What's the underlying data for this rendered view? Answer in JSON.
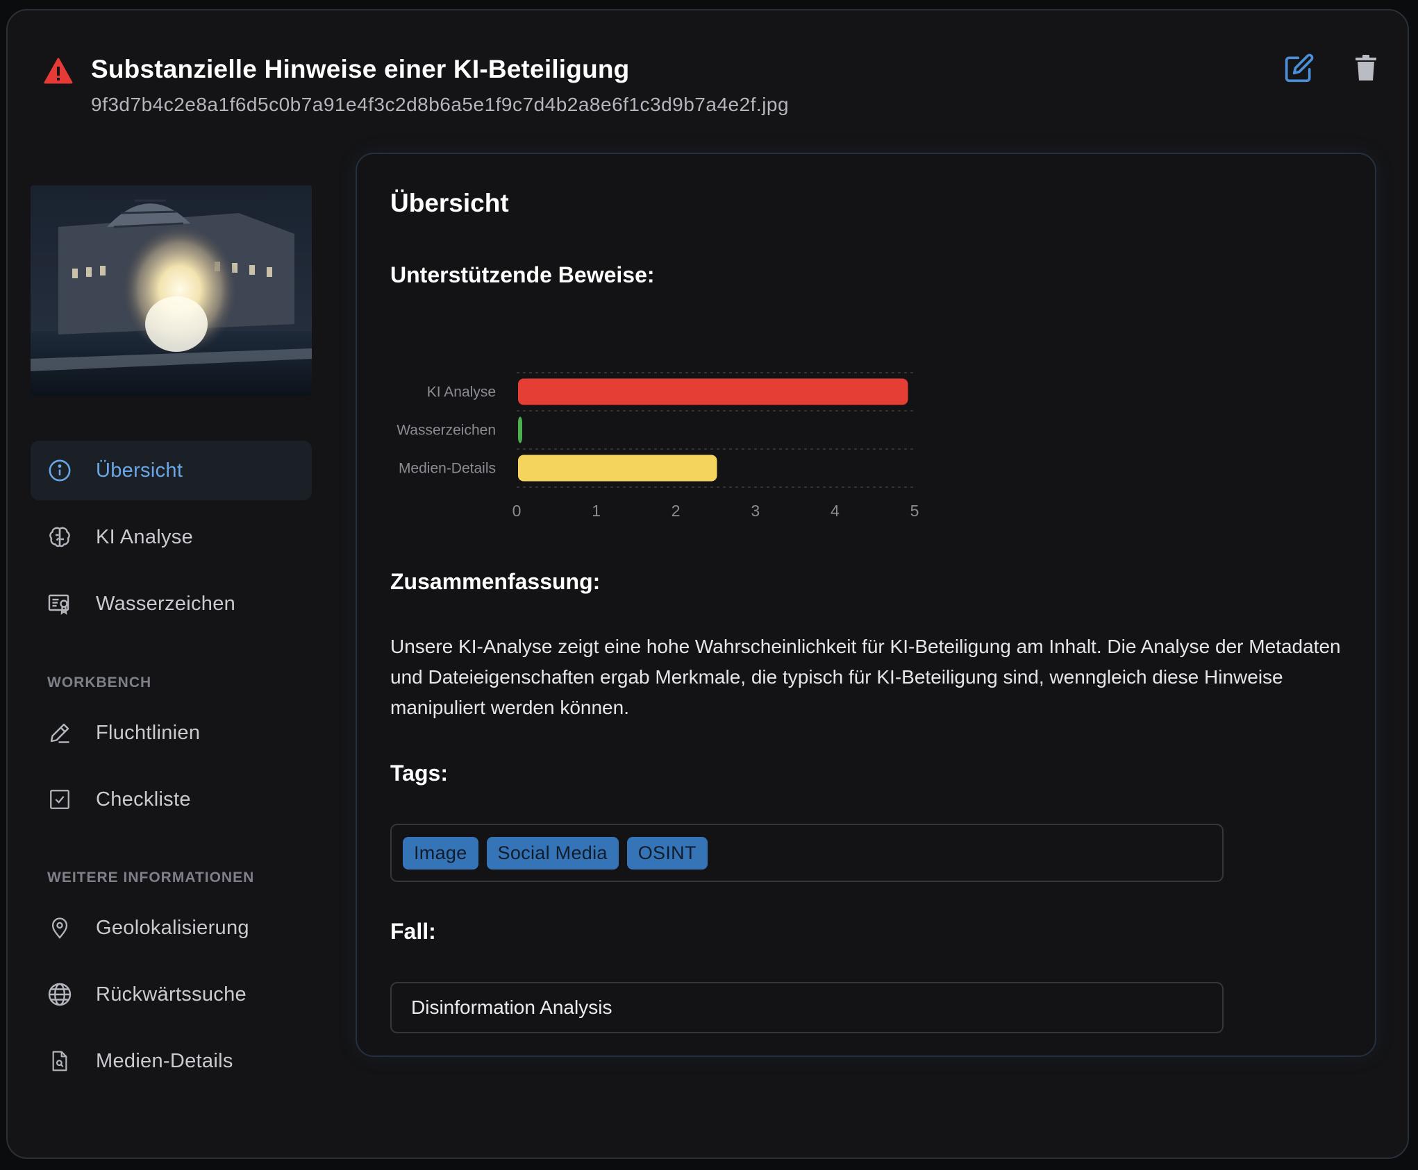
{
  "header": {
    "title": "Substanzielle Hinweise einer KI-Beteiligung",
    "filename": "9f3d7b4c2e8a1f6d5c0b7a91e4f3c2d8b6a5e1f9c7d4b2a8e6f1c3d9b7a4e2f.jpg",
    "warning_icon": "warning-triangle-icon",
    "edit_icon": "edit-icon",
    "delete_icon": "trash-icon",
    "colors": {
      "warning": "#e53a36",
      "edit": "#4a8fd8",
      "delete": "#b9bcc2"
    }
  },
  "sidebar": {
    "items": [
      {
        "label": "Übersicht",
        "icon": "info-icon",
        "active": true
      },
      {
        "label": "KI Analyse",
        "icon": "brain-icon",
        "active": false
      },
      {
        "label": "Wasserzeichen",
        "icon": "certificate-icon",
        "active": false
      }
    ],
    "workbench_label": "WORKBENCH",
    "workbench_items": [
      {
        "label": "Fluchtlinien",
        "icon": "pencil-icon"
      },
      {
        "label": "Checkliste",
        "icon": "checkbox-icon"
      }
    ],
    "more_label": "WEITERE INFORMATIONEN",
    "more_items": [
      {
        "label": "Geolokalisierung",
        "icon": "map-pin-icon"
      },
      {
        "label": "Rückwärtssuche",
        "icon": "globe-icon"
      },
      {
        "label": "Medien-Details",
        "icon": "file-search-icon"
      }
    ],
    "accent_color": "#6aa7e8"
  },
  "main": {
    "heading": "Übersicht",
    "evidence_heading": "Unterstützende Beweise:",
    "summary_heading": "Zusammenfassung:",
    "summary_text": "Unsere KI-Analyse zeigt eine hohe Wahrscheinlichkeit für KI-Beteiligung am Inhalt. Die Analyse der Metadaten und Dateieigenschaften ergab Merkmale, die typisch für KI-Beteiligung sind, wenngleich diese Hinweise manipuliert werden können.",
    "tags_heading": "Tags:",
    "tags": [
      "Image",
      "Social Media",
      "OSINT"
    ],
    "case_heading": "Fall:",
    "case_value": "Disinformation Analysis"
  },
  "chart_data": {
    "type": "bar",
    "orientation": "horizontal",
    "categories": [
      "KI Analyse",
      "Wasserzeichen",
      "Medien-Details"
    ],
    "values": [
      4.9,
      0.05,
      2.5
    ],
    "colors": [
      "#e53e34",
      "#4caf50",
      "#f5d45e"
    ],
    "xlim": [
      0,
      5
    ],
    "xticks": [
      "0",
      "1",
      "2",
      "3",
      "4",
      "5"
    ],
    "grid": true
  }
}
